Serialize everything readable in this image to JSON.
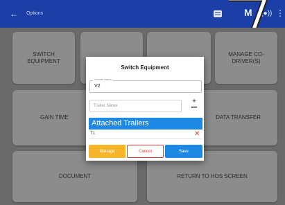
{
  "appbar": {
    "back_icon": "arrow-left-icon",
    "title": "Options",
    "icons": [
      "message-icon",
      "m-icon",
      "network-icon",
      "more-vert-icon"
    ],
    "m_label": "M"
  },
  "marker": {
    "text": "7"
  },
  "tiles": {
    "switch_equipment": "SWITCH\nEQUIPMENT",
    "manage_codriver": "MANAGE CO-\nDRIVER(S)",
    "gain_time": "GAIN TIME",
    "data_transfer": "DATA TRANSFER",
    "document": "DOCUMENT",
    "return_hos": "RETURN TO HOS SCREEN"
  },
  "dialog": {
    "title": "Switch Equipment",
    "vehicle_label": "Vehicle Name",
    "vehicle_value": "V2",
    "trailer_placeholder": "Trailer Name",
    "add_label": "ADD",
    "attached_header": "Attached Trailers",
    "trailers": [
      {
        "name": "T1"
      }
    ],
    "manage_label": "Manage",
    "cancel_label": "Cancel",
    "save_label": "Save"
  },
  "colors": {
    "appbar": "#1b3fa6",
    "accent_blue": "#1e88e5",
    "manage_yellow": "#f7b52c",
    "danger_red": "#e53935"
  }
}
